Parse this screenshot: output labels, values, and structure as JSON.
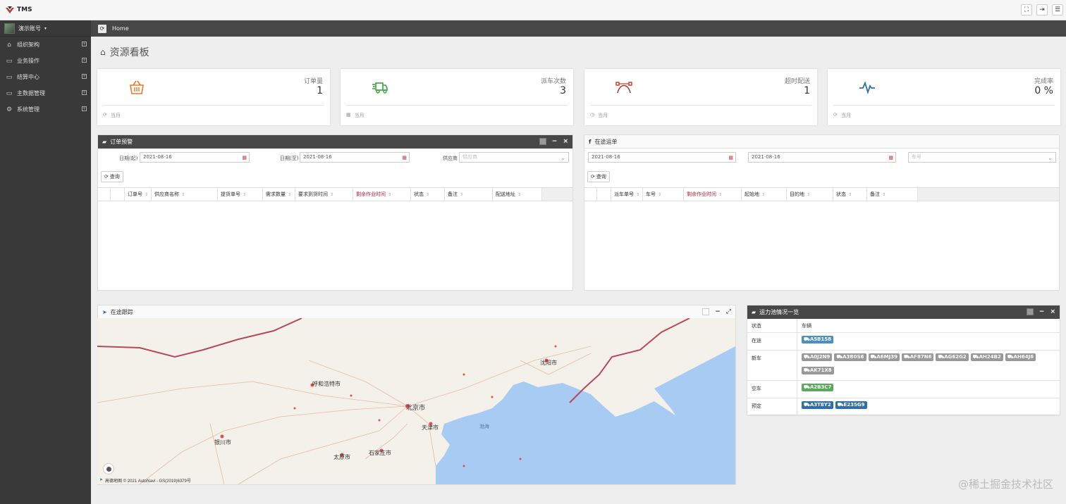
{
  "app": {
    "logo_text": "TMS"
  },
  "user": {
    "name": "演示账号"
  },
  "sidebar": {
    "items": [
      {
        "label": "组织架构",
        "icon": "home-icon"
      },
      {
        "label": "业务操作",
        "icon": "folder-icon"
      },
      {
        "label": "结算中心",
        "icon": "folder-icon"
      },
      {
        "label": "主数据管理",
        "icon": "folder-icon"
      },
      {
        "label": "系统管理",
        "icon": "gears-icon"
      }
    ]
  },
  "breadcrumb": {
    "label": "Home"
  },
  "page": {
    "title": "资源看板"
  },
  "cards": [
    {
      "label": "订单量",
      "value": "1",
      "footer": "当月",
      "color": "#e07a2e"
    },
    {
      "label": "派车次数",
      "value": "3",
      "footer": "当月",
      "color": "#3aa23a"
    },
    {
      "label": "超时配送",
      "value": "1",
      "footer": "当月",
      "color": "#c0392b"
    },
    {
      "label": "完成率",
      "value": "0 %",
      "footer": "当月",
      "color": "#2a6fae"
    }
  ],
  "order_warning": {
    "title": "订单预警",
    "date_start_label": "日期(起)",
    "date_start_value": "2021-08-16",
    "date_end_label": "日期(至)",
    "date_end_value": "2021-08-16",
    "supplier_label": "供应商",
    "supplier_placeholder": "供应商",
    "query_label": "查询",
    "columns": [
      "订单号",
      "供应商名称",
      "提货单号",
      "需求数量",
      "要求到货时间",
      "剩余作业时间",
      "状态",
      "备注",
      "配送地址"
    ]
  },
  "in_transit": {
    "title": "在途运单",
    "date_start_value": "2021-08-16",
    "date_end_value": "2021-08-16",
    "plate_placeholder": "车号",
    "query_label": "查询",
    "columns": [
      "派车单号",
      "车号",
      "剩余作业时间",
      "起始地",
      "目的地",
      "状态",
      "备注"
    ]
  },
  "tracking": {
    "title": "在途跟踪",
    "map_labels": {
      "beijing": "北京市",
      "tianjin": "天津市",
      "shijiazhuang": "石家庄市",
      "taiyuan": "太原市",
      "hohhot": "呼和浩特市",
      "shenyang": "沈阳市",
      "yinchuan": "银川市",
      "bohai": "渤海"
    },
    "attribution": "高德地图 © 2021 AutoNavi - GS(2019)6379号"
  },
  "capacity": {
    "title": "运力池情况一览",
    "header_status": "状态",
    "header_vehicle": "车辆",
    "rows": [
      {
        "status": "在途",
        "color": "blue",
        "vehicles": [
          "A5B158"
        ]
      },
      {
        "status": "新车",
        "color": "grey",
        "vehicles": [
          "A0J2N9",
          "A3B0S6",
          "A6MJ39",
          "AF87N6",
          "AG62G2",
          "AH24B2",
          "AH64J6",
          "AK71X8"
        ]
      },
      {
        "status": "空车",
        "color": "green",
        "vehicles": [
          "A2B3C7"
        ]
      },
      {
        "status": "预定",
        "color": "dark",
        "vehicles": [
          "A3T8Y2",
          "E235G9"
        ]
      }
    ]
  },
  "watermark": "@稀土掘金技术社区"
}
